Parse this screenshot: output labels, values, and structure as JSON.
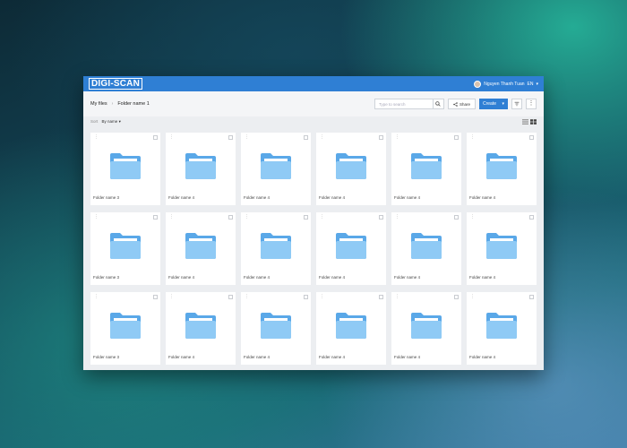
{
  "app": {
    "logo": "DIGI-SCAN"
  },
  "header": {
    "user_name": "Nguyen Thanh Tuan",
    "language": "EN"
  },
  "breadcrumb": {
    "root": "My files",
    "current": "Folder name 1"
  },
  "toolbar": {
    "search_placeholder": "Type to search",
    "share_label": "Share",
    "create_label": "Create"
  },
  "sort": {
    "label": "Sort",
    "value": "By name"
  },
  "folders": [
    "Folder name 3",
    "Folder name 4",
    "Folder name 4",
    "Folder name 4",
    "Folder name 4",
    "Folder name 4",
    "Folder name 3",
    "Folder name 4",
    "Folder name 4",
    "Folder name 4",
    "Folder name 4",
    "Folder name 4",
    "Folder name 3",
    "Folder name 4",
    "Folder name 4",
    "Folder name 4",
    "Folder name 4",
    "Folder name 4"
  ],
  "colors": {
    "brand": "#2f7fd4",
    "folder": "#8fcaf5",
    "folder_tab": "#5aa8e8"
  }
}
